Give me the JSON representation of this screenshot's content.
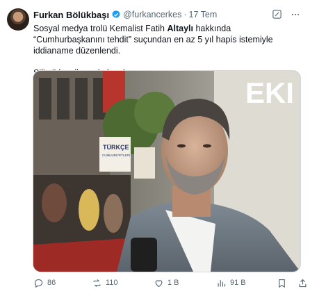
{
  "author": {
    "name": "Furkan Bölükbaşı",
    "handle": "@furkancerkes",
    "separator": "·",
    "date": "17 Tem"
  },
  "tweet": {
    "line1_pre": "Sosyal medya trolü Kemalist Fatih ",
    "line1_bold": "Altaylı",
    "line1_post": " hakkında “Cumhurbaşkanını tehdit” suçundan en az 5 yıl hapis istemiyle iddianame düzenlendi.",
    "line2": "Silivri'de yıllarca kalacaksın."
  },
  "media": {
    "sign_text_1": "TÜRKÇE",
    "sign_text_2": "CUMHURIYETLERI",
    "wall_letters": "EKI"
  },
  "actions": {
    "replies": "86",
    "reposts": "110",
    "likes": "1 B",
    "views": "91 B"
  },
  "colors": {
    "text": "#0f1419",
    "secondary": "#536471",
    "verified": "#1d9bf0"
  }
}
